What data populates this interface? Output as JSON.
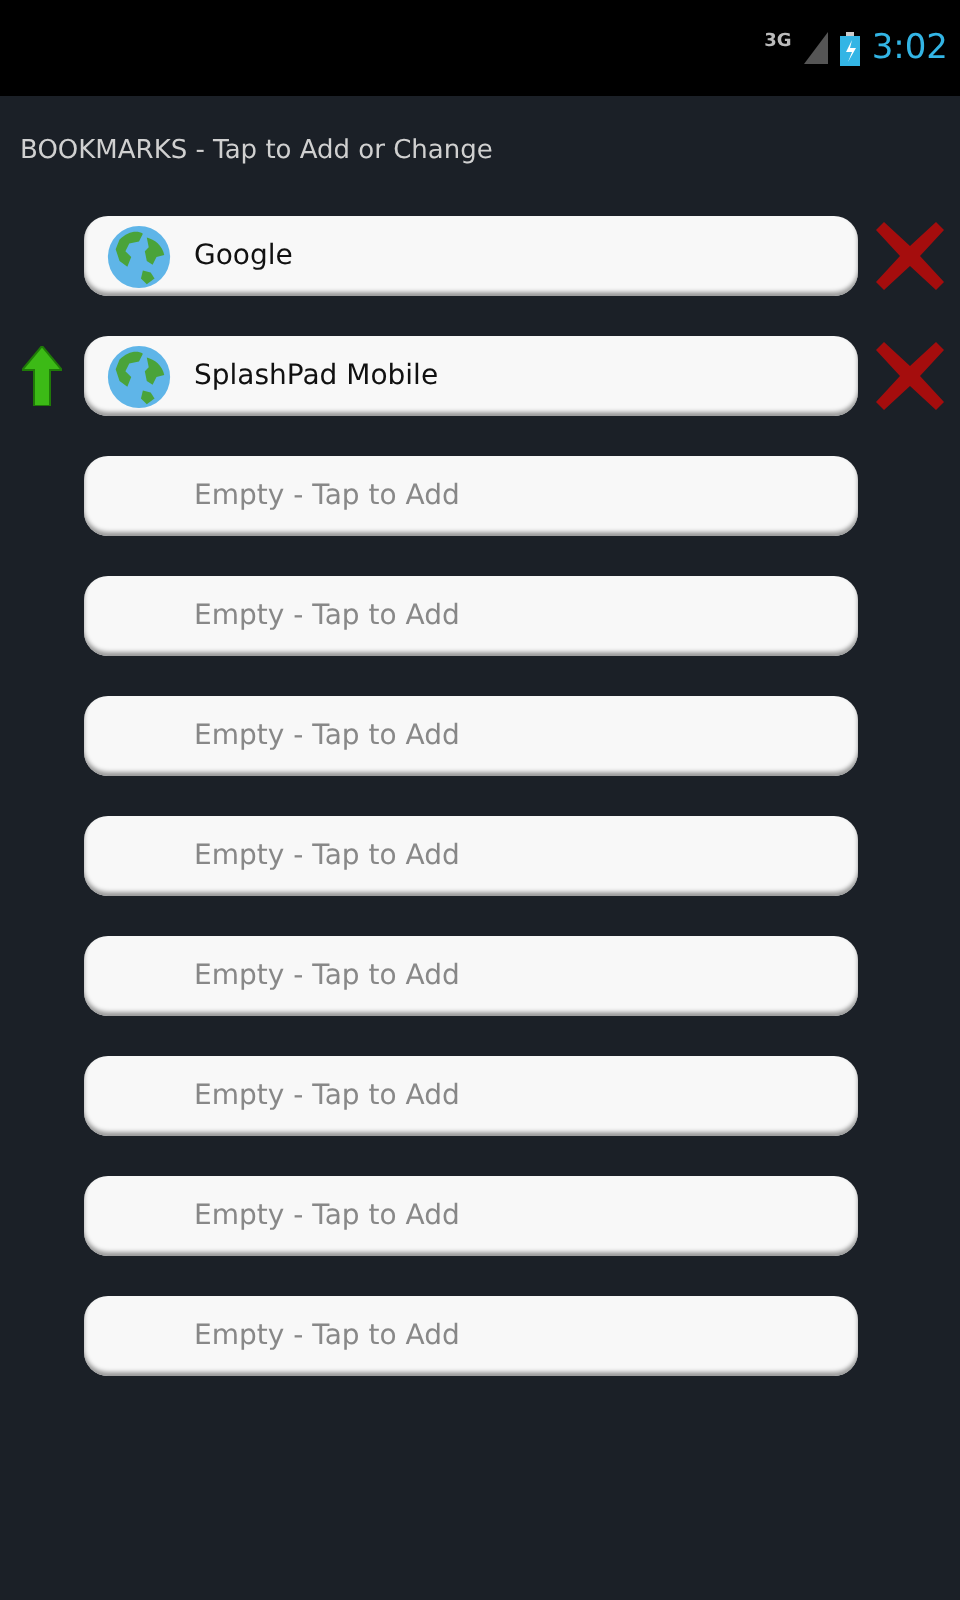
{
  "status_bar": {
    "network": "3G",
    "time": "3:02"
  },
  "header": "BOOKMARKS - Tap to Add or Change",
  "bookmarks": [
    {
      "kind": "filled",
      "label": "Google",
      "can_move_up": false
    },
    {
      "kind": "filled",
      "label": "SplashPad Mobile",
      "can_move_up": true
    },
    {
      "kind": "empty",
      "label": "Empty - Tap to Add"
    },
    {
      "kind": "empty",
      "label": "Empty - Tap to Add"
    },
    {
      "kind": "empty",
      "label": "Empty - Tap to Add"
    },
    {
      "kind": "empty",
      "label": "Empty - Tap to Add"
    },
    {
      "kind": "empty",
      "label": "Empty - Tap to Add"
    },
    {
      "kind": "empty",
      "label": "Empty - Tap to Add"
    },
    {
      "kind": "empty",
      "label": "Empty - Tap to Add"
    },
    {
      "kind": "empty",
      "label": "Empty - Tap to Add"
    }
  ]
}
